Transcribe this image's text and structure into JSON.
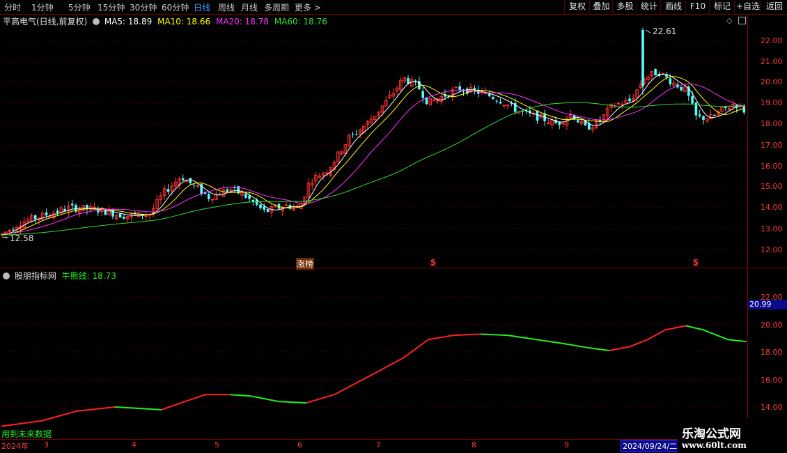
{
  "topbar": {
    "periods": [
      "分时",
      "1分钟",
      "5分钟",
      "15分钟",
      "30分钟",
      "60分钟",
      "日线",
      "周线",
      "月线",
      "多周期",
      "更多 >"
    ],
    "active_period": "日线",
    "tools": [
      "复权",
      "叠加",
      "多股",
      "统计",
      "画线",
      "F10",
      "标记",
      "+自选",
      "返回"
    ]
  },
  "main_chart": {
    "stock_title": "平高电气(日线,前复权)",
    "ma5_label": "MA5: 18.89",
    "ma10_label": "MA10: 18.66",
    "ma20_label": "MA20: 18.78",
    "ma60_label": "MA60: 18.76",
    "high_annotation": "22.61",
    "low_annotation": "12.58",
    "y_ticks": [
      "22.00",
      "21.00",
      "20.00",
      "19.00",
      "18.00",
      "17.00",
      "16.00",
      "15.00",
      "14.00",
      "13.00",
      "12.00"
    ],
    "markers": [
      "涨榜",
      "S",
      "S"
    ],
    "ma_colors": {
      "ma5": "#ffffff",
      "ma10": "#ffff00",
      "ma20": "#ff33ff",
      "ma60": "#33dd33"
    }
  },
  "indicator_chart": {
    "name": "股朋指标网",
    "line_label": "牛熊线: 18.73",
    "y_ticks": [
      "22.00",
      "20.00",
      "18.00",
      "16.00",
      "14.00"
    ],
    "cursor_value": "20.99",
    "footer_note": "用到未来数据",
    "up_color": "#ff2222",
    "down_color": "#22ee22"
  },
  "date_axis": {
    "year_label": "2024年",
    "month_labels": [
      "3",
      "4",
      "5",
      "6",
      "7",
      "8",
      "9"
    ],
    "current_date": "2024/09/24/二"
  },
  "watermark": {
    "line1": "乐淘公式网",
    "line2": "www.60lt.com"
  }
}
